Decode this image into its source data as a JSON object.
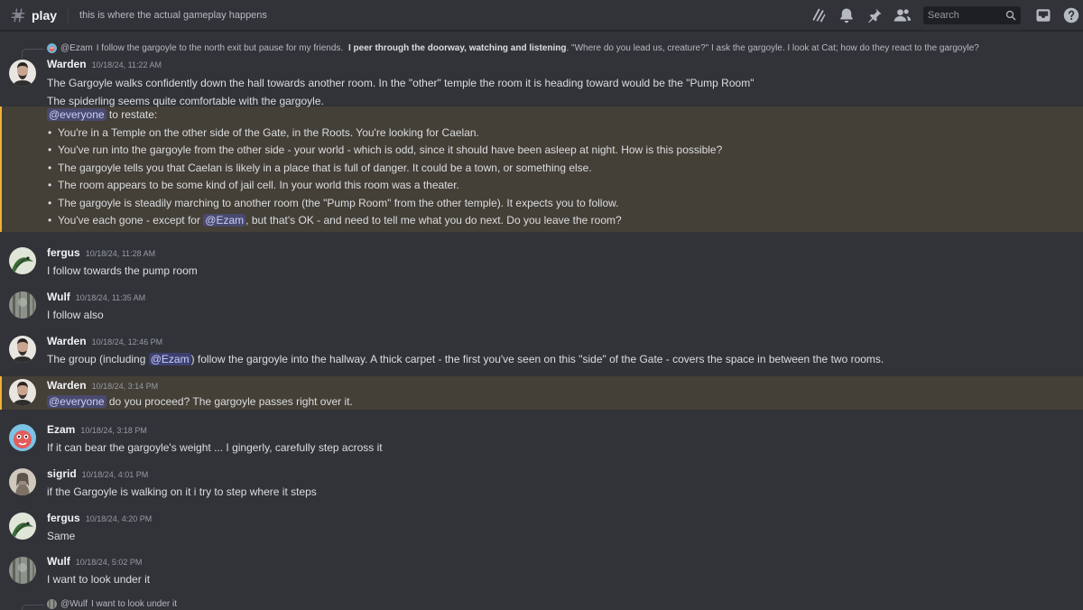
{
  "channel": {
    "name": "play",
    "topic": "this is where the actual gameplay happens"
  },
  "toolbar": {
    "search_placeholder": "Search",
    "icons": [
      "threads-icon",
      "bell-icon",
      "pin-icon",
      "members-icon",
      "search-icon",
      "inbox-icon",
      "help-icon"
    ]
  },
  "colors": {
    "background": "#313338",
    "mention_highlight": "#f0b132",
    "mention_tag": "#5865f2"
  },
  "reply_top": {
    "user": "@Ezam",
    "text_a": "I follow the gargoyle to the north exit but pause for my friends.",
    "text_bold": "I peer through the doorway, watching and listening",
    "text_b": ". \"Where do you lead us, creature?\" I ask the gargoyle. I look at Cat; how do they react to the gargoyle?"
  },
  "messages": [
    {
      "author": "Warden",
      "timestamp": "10/18/24, 11:22 AM",
      "lines": [
        "The Gargoyle walks confidently down the hall towards another room. In the \"other\" temple the room it is heading toward would be the \"Pump Room\"",
        "The spiderling seems quite comfortable with the gargoyle."
      ]
    },
    {
      "mention": "@everyone",
      "intro": " to restate:",
      "bullets": [
        "You're in a Temple on the other side of the Gate, in the Roots. You're looking for Caelan.",
        "You've run into the gargoyle from the other side - your world - which is odd, since it should have been asleep at night. How is this possible?",
        "The gargoyle tells you that Caelan is likely in a place that is full of danger. It could be a town, or something else.",
        "The room appears to be some kind of jail cell. In your world this room was a theater.",
        "The gargoyle is steadily marching to another room (the \"Pump Room\" from the other temple). It expects you to follow."
      ],
      "last_bullet_a": "You've each gone - except for ",
      "last_bullet_mention": "@Ezam",
      "last_bullet_b": ", but that's OK - and need to tell me what you do next. Do you leave the room?"
    },
    {
      "author": "fergus",
      "timestamp": "10/18/24, 11:28 AM",
      "text": "I follow towards the pump room"
    },
    {
      "author": "Wulf",
      "timestamp": "10/18/24, 11:35 AM",
      "text": "I follow also"
    },
    {
      "author": "Warden",
      "timestamp": "10/18/24, 12:46 PM",
      "text_a": "The group (including ",
      "mention": "@Ezam",
      "text_b": ") follow the gargoyle into the hallway. A thick carpet - the first you've seen on this \"side\" of the Gate - covers the space in between the two rooms."
    },
    {
      "author": "Warden",
      "timestamp": "10/18/24, 3:14 PM",
      "mention": "@everyone",
      "text": " do you proceed? The gargoyle passes right over it."
    },
    {
      "author": "Ezam",
      "timestamp": "10/18/24, 3:18 PM",
      "text": "If it can bear the gargoyle's weight ... I gingerly, carefully step across it"
    },
    {
      "author": "sigrid",
      "timestamp": "10/18/24, 4:01 PM",
      "text": "if the Gargoyle is walking on it i try to step where it steps"
    },
    {
      "author": "fergus",
      "timestamp": "10/18/24, 4:20 PM",
      "text": "Same"
    },
    {
      "author": "Wulf",
      "timestamp": "10/18/24, 5:02 PM",
      "text": "I want to look under it"
    }
  ],
  "reply_bottom": {
    "user": "@Wulf",
    "text": "I want to look under it"
  }
}
